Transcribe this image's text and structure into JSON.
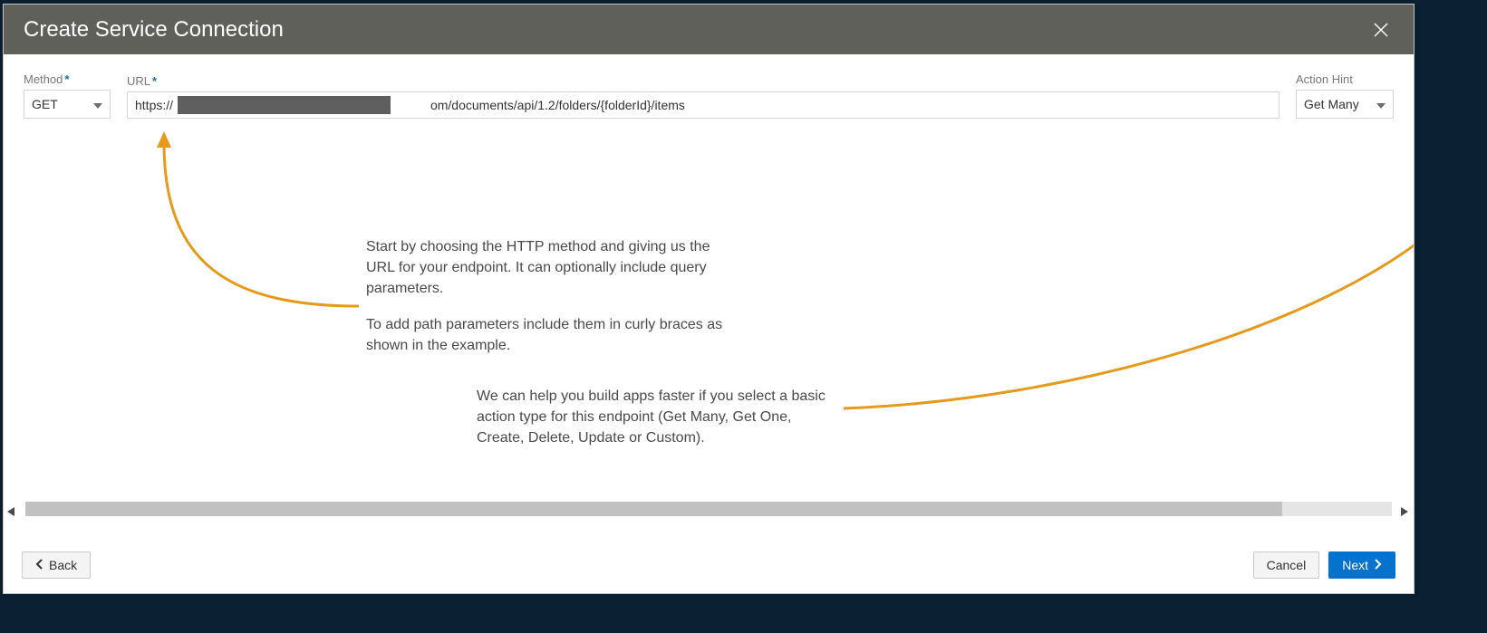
{
  "dialog": {
    "title": "Create Service Connection"
  },
  "form": {
    "method": {
      "label": "Method",
      "value": "GET"
    },
    "url": {
      "label": "URL",
      "value_prefix": "https://",
      "value_suffix": "om/documents/api/1.2/folders/{folderId}/items",
      "value": "https://                                                                         om/documents/api/1.2/folders/{folderId}/items"
    },
    "action_hint": {
      "label": "Action Hint",
      "value": "Get Many"
    }
  },
  "help": {
    "p1": "Start by choosing the HTTP method and giving us the URL for your endpoint. It can optionally include query parameters.",
    "p2": "To add path parameters include them in curly braces as shown in the example.",
    "p3": "We can help you build apps faster if you select a basic action type for this endpoint (Get Many, Get One, Create, Delete, Update or Custom)."
  },
  "footer": {
    "back": "Back",
    "cancel": "Cancel",
    "next": "Next"
  },
  "colors": {
    "accent_arrow": "#e59a1c",
    "primary_button": "#0572ce"
  }
}
